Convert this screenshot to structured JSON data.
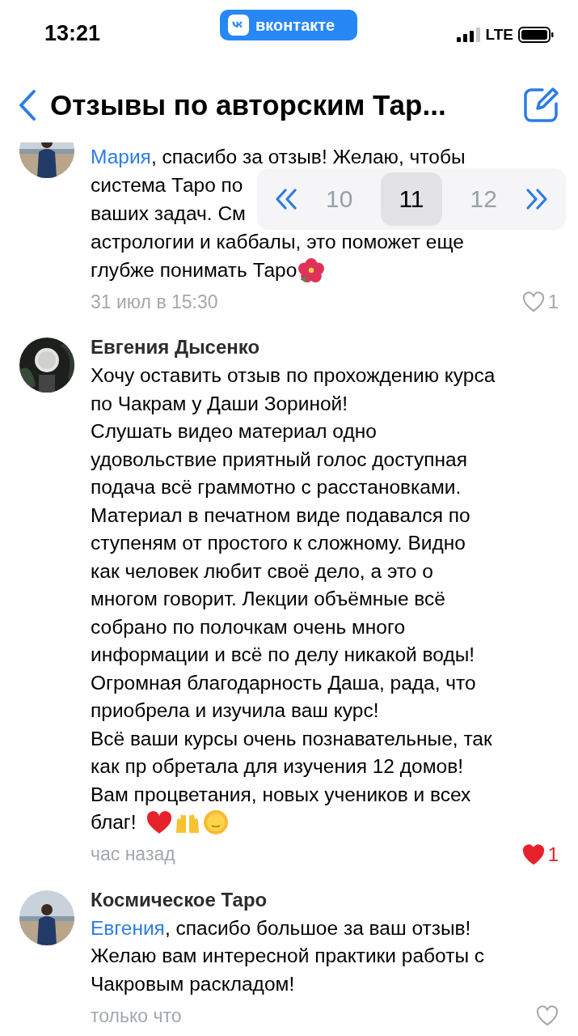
{
  "status_bar": {
    "time": "13:21",
    "app_badge": "вконтакте",
    "network": "LTE"
  },
  "header": {
    "title": "Отзывы по авторским Тар..."
  },
  "pagination": {
    "pages": [
      {
        "label": "10",
        "selected": false
      },
      {
        "label": "11",
        "selected": true
      },
      {
        "label": "12",
        "selected": false
      }
    ]
  },
  "comments": [
    {
      "mention": "Мария",
      "lines": [
        ", спасибо за отзыв! Желаю, чтобы",
        "система Таро по",
        "ваших задач. См",
        "астрологии и каббалы, это поможет еще",
        "глубже понимать Таро"
      ],
      "time": "31 июл в 15:30",
      "liked": false,
      "like_count": "1"
    },
    {
      "author": "Евгения Дысенко",
      "lines": [
        "Хочу оставить отзыв по прохождению курса",
        "по Чакрам у Даши Зориной!",
        "Слушать видео материал одно",
        "удовольствие приятный голос доступная",
        "подача всё граммотно с расстановками.",
        "Материал в печатном виде подавался по",
        "ступеням от простого к сложному. Видно",
        "как человек любит своё дело, а это о",
        "многом говорит. Лекции объёмные всё",
        "собрано по полочкам  очень много",
        "информации и всё по делу никакой воды!",
        "Огромная благодарность Даша, рада, что",
        "приобрела и изучила ваш курс!",
        "Всё ваши курсы очень познавательные, так",
        "как пр обретала для изучения 12 домов!",
        "Вам процветания, новых учеников и всех",
        "благ!"
      ],
      "time": "час назад",
      "liked": true,
      "like_count": "1"
    },
    {
      "author": "Космическое Таро",
      "mention": "Евгения",
      "lines": [
        ", спасибо большое за ваш отзыв!",
        "Желаю вам интересной практики работы с",
        "Чакровым раскладом!"
      ],
      "time": "только что",
      "liked": false
    }
  ]
}
